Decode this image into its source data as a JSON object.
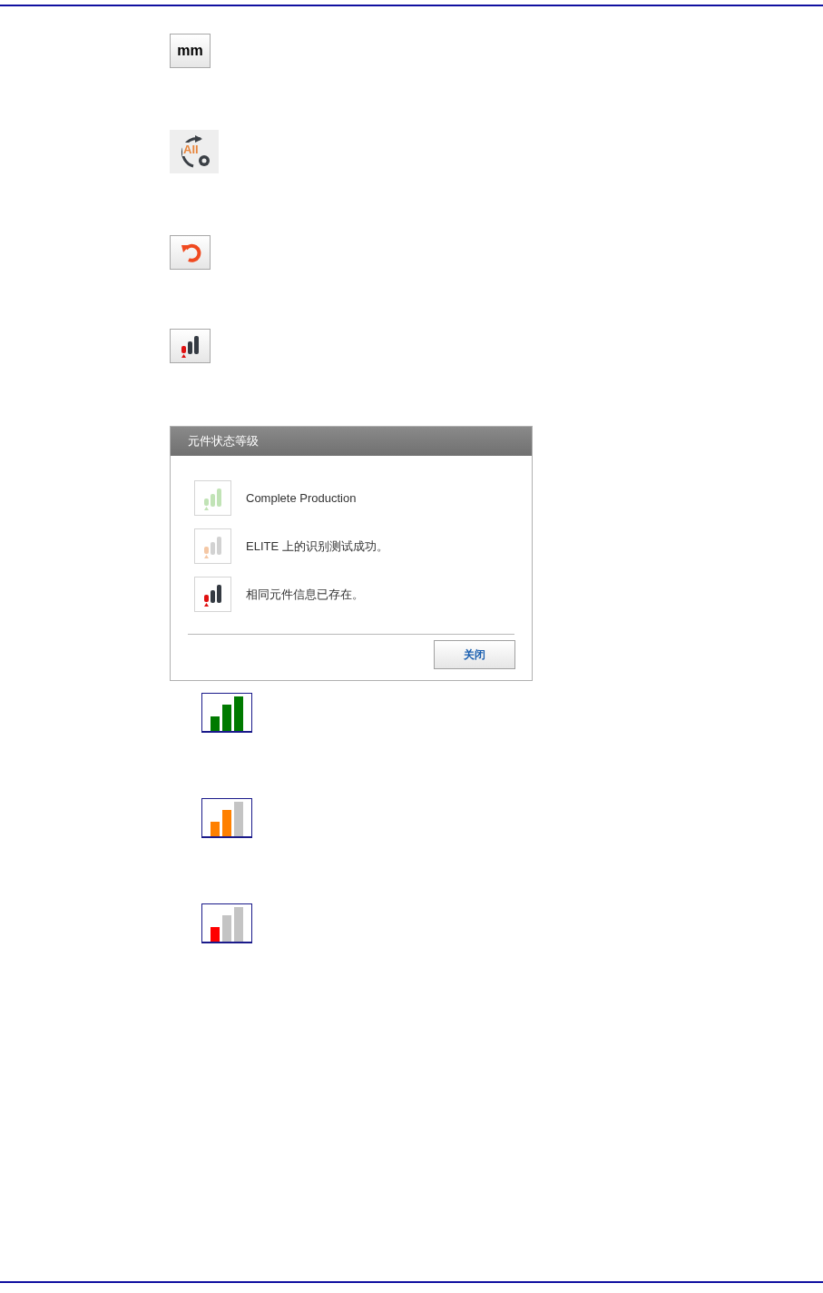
{
  "toolbar_icons": [
    {
      "kind": "unit",
      "label": "mm"
    },
    {
      "kind": "all-settings",
      "label": "All"
    },
    {
      "kind": "undo"
    },
    {
      "kind": "signal"
    }
  ],
  "dialog": {
    "title": "元件状态等级",
    "items": [
      {
        "kind": "complete",
        "label": "Complete Production"
      },
      {
        "kind": "tested",
        "label": "ELITE 上的识别测试成功。"
      },
      {
        "kind": "exists",
        "label": "相同元件信息已存在。"
      }
    ],
    "button": "关闭"
  },
  "level_icons": [
    {
      "color": "#007a00",
      "kind": "high"
    },
    {
      "color": "#ff8000",
      "kind": "medium"
    },
    {
      "color": "#ff0000",
      "kind": "low"
    }
  ]
}
